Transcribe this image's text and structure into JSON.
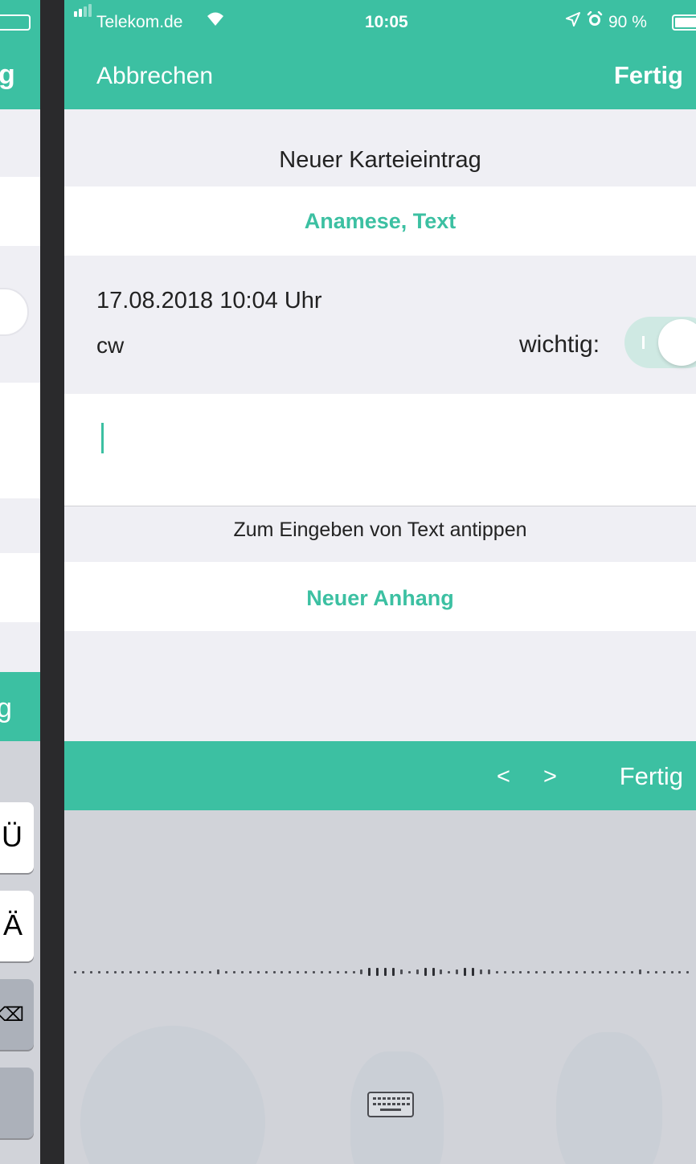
{
  "background_app": {
    "nav_glyph": "g",
    "button_glyph": "g",
    "keys": [
      "Ü",
      "Ä",
      "⌫"
    ]
  },
  "status_bar": {
    "carrier": "Telekom.de",
    "time": "10:05",
    "battery": "90 %",
    "battery_level": 0.9,
    "icons": [
      "signal-icon",
      "wifi-icon",
      "location-icon",
      "alarm-icon",
      "battery-icon"
    ]
  },
  "nav": {
    "cancel_label": "Abbrechen",
    "done_label": "Fertig"
  },
  "form": {
    "section_title": "Neuer Karteieintrag",
    "category": "Anamese, Text",
    "datetime": "17.08.2018 10:04 Uhr",
    "author": "cw",
    "important_label": "wichtig:",
    "important_on": false,
    "text_value": "",
    "hint": "Zum Eingeben von Text antippen",
    "attachment_label": "Neuer Anhang"
  },
  "input_toolbar": {
    "prev_label": "<",
    "next_label": ">",
    "done_label": "Fertig"
  },
  "dictation": {
    "keyboard_icon": "keyboard-icon"
  },
  "colors": {
    "accent": "#3cc0a2",
    "background": "#efeff4",
    "keyboard": "#d1d3d9"
  }
}
